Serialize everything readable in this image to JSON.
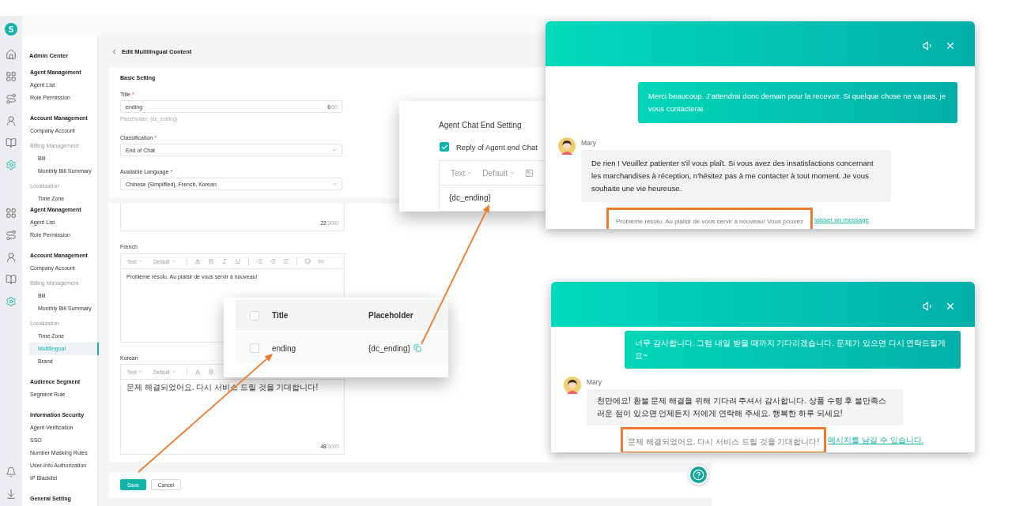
{
  "top_screen": {
    "logo": "S",
    "rail": [
      {
        "kind": "home",
        "selected": false
      },
      {
        "kind": "apps",
        "selected": false
      },
      {
        "kind": "routes",
        "selected": false
      },
      {
        "kind": "agent",
        "selected": false
      },
      {
        "kind": "book",
        "selected": false
      },
      {
        "kind": "settings",
        "selected": true
      }
    ],
    "sidebar": {
      "title": "Admin Center",
      "sections": [
        {
          "heading": "Agent Management",
          "items": [
            {
              "label": "Agent List",
              "selected": false
            },
            {
              "label": "Role Permission",
              "selected": false
            }
          ]
        },
        {
          "heading": "Account Management",
          "items": [
            {
              "label": "Company Account",
              "selected": false
            },
            {
              "label": "Billing Management",
              "children": [
                {
                  "label": "Bill",
                  "selected": false
                },
                {
                  "label": "Monthly Bill Summary",
                  "selected": false
                }
              ]
            },
            {
              "label": "Localization",
              "children": [
                {
                  "label": "Time Zone",
                  "selected": false
                }
              ]
            }
          ]
        }
      ]
    },
    "page": {
      "title": "Edit Multilingual Content",
      "card_title": "Basic Setting",
      "fields": [
        {
          "kind": "text",
          "label": "Title",
          "mark": "*",
          "value": "ending",
          "count": "6",
          "limit": "/50",
          "hint": "Placeholder: {dc_ending}"
        },
        {
          "kind": "select",
          "label": "Classification",
          "mark": "*",
          "value": "End of Chat"
        },
        {
          "kind": "select",
          "label": "Available Language",
          "mark": "*",
          "value": "Chinese (Simplified), French, Korean"
        }
      ]
    }
  },
  "bottom_screen": {
    "rail": [
      {
        "kind": "apps",
        "selected": false
      },
      {
        "kind": "routes",
        "selected": false
      },
      {
        "kind": "agent",
        "selected": false
      },
      {
        "kind": "book",
        "selected": false
      },
      {
        "kind": "settings",
        "selected": true
      }
    ],
    "rail_bottom": [
      {
        "kind": "bell",
        "selected": false
      },
      {
        "kind": "download",
        "selected": false
      }
    ],
    "sidebar": {
      "sections": [
        {
          "heading": "Agent Management",
          "items": [
            {
              "label": "Agent List",
              "selected": false
            },
            {
              "label": "Role Permission",
              "selected": false
            }
          ]
        },
        {
          "heading": "Account Management",
          "items": [
            {
              "label": "Company Account",
              "selected": false
            },
            {
              "label": "Billing Management",
              "children": [
                {
                  "label": "Bill",
                  "selected": false
                },
                {
                  "label": "Monthly Bill Summary",
                  "selected": false
                }
              ]
            },
            {
              "label": "Localization",
              "children": [
                {
                  "label": "Time Zone",
                  "selected": false
                },
                {
                  "label": "Multilingual",
                  "selected": true
                },
                {
                  "label": "Brand",
                  "selected": false
                }
              ]
            }
          ]
        },
        {
          "heading": "Audience Segment",
          "items": [
            {
              "label": "Segment Rule",
              "selected": false
            }
          ]
        },
        {
          "heading": "Information Security",
          "items": [
            {
              "label": "Agent Verification",
              "selected": false
            },
            {
              "label": "SSO",
              "selected": false
            },
            {
              "label": "Number Masking Rules",
              "selected": false
            },
            {
              "label": "User-Info Authorization",
              "selected": false
            },
            {
              "label": "IP Blacklist",
              "selected": false
            }
          ]
        },
        {
          "heading": "General Setting"
        }
      ]
    },
    "editors": [
      {
        "kind": "partial",
        "count": "22",
        "limit": "/3000"
      },
      {
        "kind": "full",
        "label": "French",
        "tools": [
          {
            "kind": "menu",
            "label": "Text"
          },
          {
            "kind": "menu",
            "label": "Default"
          },
          {
            "kind": "divider"
          },
          {
            "kind": "font-color"
          },
          {
            "kind": "bold"
          },
          {
            "kind": "italic"
          },
          {
            "kind": "underline"
          },
          {
            "kind": "divider"
          },
          {
            "kind": "indent"
          },
          {
            "kind": "outdent"
          },
          {
            "kind": "align"
          },
          {
            "kind": "divider"
          },
          {
            "kind": "emoji"
          },
          {
            "kind": "link"
          }
        ],
        "text": "Problème résolu. Au plaisir de vous servir à nouveau!"
      },
      {
        "kind": "full",
        "label": "Korean",
        "tools": [
          {
            "kind": "menu",
            "label": "Text"
          },
          {
            "kind": "menu",
            "label": "Default"
          },
          {
            "kind": "divider"
          },
          {
            "kind": "font-color"
          },
          {
            "kind": "bold"
          }
        ],
        "text": "문제 해결되었어요. 다시 서비스 드릴 것을 기대합니다!",
        "count": "48",
        "limit": "/3000"
      }
    ],
    "actions": [
      {
        "kind": "primary",
        "label": "Save"
      },
      {
        "kind": "secondary",
        "label": "Cancel"
      }
    ]
  },
  "end_setting_popup": {
    "title": "Agent Chat End Setting",
    "option": {
      "label": "Reply of Agent end Chat",
      "checked": true
    },
    "tools": [
      {
        "kind": "menu",
        "label": "Text"
      },
      {
        "kind": "menu",
        "label": "Default"
      },
      {
        "kind": "image"
      }
    ],
    "text": "{dc_ending}"
  },
  "placeholder_table": {
    "all_selected": false,
    "columns": [
      "Title",
      "Placeholder"
    ],
    "rows": [
      {
        "selected": false,
        "title": "ending",
        "placeholder": "{dc_ending}"
      }
    ]
  },
  "chats": [
    {
      "messages": [
        {
          "kind": "visitor",
          "text": "Merci beaucoup. J’attendrai donc demain pour la recevoir. Si quelque chose ne va pas, je vous contacterai"
        },
        {
          "kind": "agent",
          "name": "Mary",
          "text": "De rien ! Veuillez patienter s'il vous plaît. Si vous avez des insatisfactions concernant les marchandises à réception, n'hésitez pas à me contacter à tout moment. Je vous souhaite une vie heureuse."
        },
        {
          "kind": "system",
          "text": "Problème résolu. Au plaisir de vous servir à nouveau! Vous pouvez",
          "link": "laisser un message",
          "highlighted": true
        }
      ]
    },
    {
      "messages": [
        {
          "kind": "visitor",
          "text": "너무 감사합니다. 그럼 내일 받을 때까지 기다리겠습니다. 문제가 있으면 다시 연락드릴게요~"
        },
        {
          "kind": "agent",
          "name": "Mary",
          "text": "천만에요! 환불 문제 해결을 위해 기다려 주셔서 감사합니다. 상품 수령 후 불만족스러운 점이 있으면 언제든지 저에게 연락해 주세요. 행복한 하루 되세요!"
        },
        {
          "kind": "system",
          "text": "문제 해결되었어요. 다시 서비스 드릴 것을 기대합니다!",
          "link": "메시지를 남길 수 있습니다.",
          "highlighted": true
        }
      ]
    }
  ]
}
